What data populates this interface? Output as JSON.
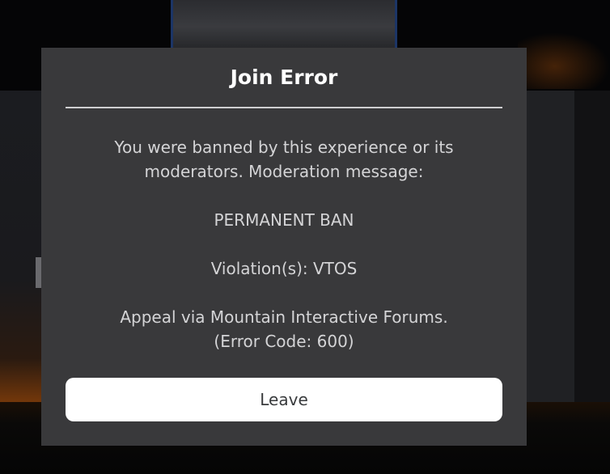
{
  "dialog": {
    "title": "Join Error",
    "message_lines": [
      "You were banned by this experience or its",
      "moderators. Moderation message:",
      "PERMANENT BAN",
      "Violation(s): VTOS",
      "Appeal via Mountain Interactive Forums.",
      "(Error Code: 600)"
    ],
    "leave_label": "Leave"
  },
  "colors": {
    "dialog_background": "#39393b",
    "title_text": "#ffffff",
    "body_text": "#d4d4d6",
    "button_background": "#ffffff",
    "button_text": "#393b3d"
  }
}
